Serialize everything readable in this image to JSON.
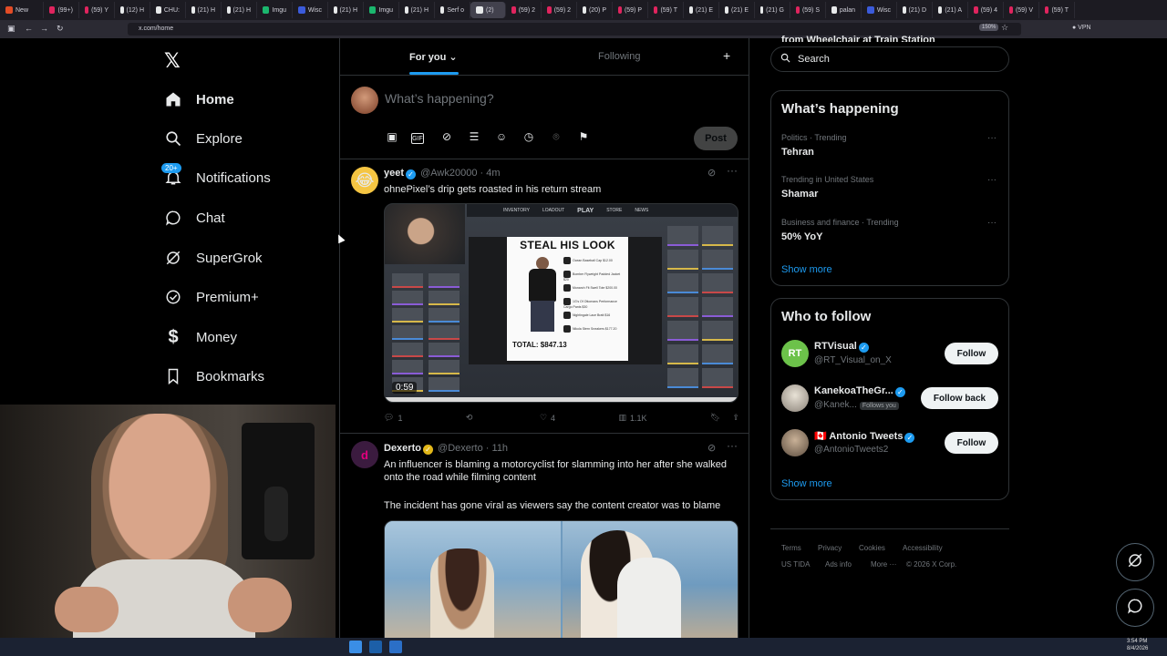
{
  "browser": {
    "tabs": [
      {
        "label": "New",
        "color": "#e34c26"
      },
      {
        "label": "(99+)",
        "color": "#e0245e"
      },
      {
        "label": "(59) Y",
        "color": "#e0245e"
      },
      {
        "label": "(12) H",
        "color": "#e7e9ea"
      },
      {
        "label": "CHU:",
        "color": "#e7e9ea"
      },
      {
        "label": "(21) H",
        "color": "#e7e9ea"
      },
      {
        "label": "(21) H",
        "color": "#e7e9ea"
      },
      {
        "label": "Imgu",
        "color": "#1bb76e"
      },
      {
        "label": "Wisc",
        "color": "#3b5bdb"
      },
      {
        "label": "(21) H",
        "color": "#e7e9ea"
      },
      {
        "label": "Imgu",
        "color": "#1bb76e"
      },
      {
        "label": "(21) H",
        "color": "#e7e9ea"
      },
      {
        "label": "Serf o",
        "color": "#e7e9ea"
      },
      {
        "label": "(2)",
        "color": "#e7e9ea",
        "active": true
      },
      {
        "label": "(59) 2",
        "color": "#e0245e"
      },
      {
        "label": "(59) 2",
        "color": "#e0245e"
      },
      {
        "label": "(20) P",
        "color": "#e7e9ea"
      },
      {
        "label": "(59) P",
        "color": "#e0245e"
      },
      {
        "label": "(59) T",
        "color": "#e0245e"
      },
      {
        "label": "(21) E",
        "color": "#e7e9ea"
      },
      {
        "label": "(21) E",
        "color": "#e7e9ea"
      },
      {
        "label": "(21) G",
        "color": "#e7e9ea"
      },
      {
        "label": "(59) S",
        "color": "#e0245e"
      },
      {
        "label": "palan",
        "color": "#e7e9ea"
      },
      {
        "label": "Wisc",
        "color": "#3b5bdb"
      },
      {
        "label": "(21) D",
        "color": "#e7e9ea"
      },
      {
        "label": "(21) A",
        "color": "#e7e9ea"
      },
      {
        "label": "(59) 4",
        "color": "#e0245e"
      },
      {
        "label": "(59) V",
        "color": "#e0245e"
      },
      {
        "label": "(59) T",
        "color": "#e0245e"
      }
    ],
    "url": "x.com/home",
    "zoom": "150%",
    "vpn": "VPN"
  },
  "nav": {
    "home": "Home",
    "explore": "Explore",
    "notifications": "Notifications",
    "notifications_badge": "20+",
    "chat": "Chat",
    "supergrok": "SuperGrok",
    "premium": "Premium+",
    "money": "Money",
    "bookmarks": "Bookmarks"
  },
  "feed_tabs": {
    "for_you": "For you",
    "following": "Following"
  },
  "compose": {
    "placeholder": "What’s happening?",
    "post": "Post"
  },
  "tweets": [
    {
      "name": "yeet",
      "handle": "@Awk20000",
      "time": "4m",
      "text": "ohnePixel’s drip gets roasted in his return stream",
      "media": {
        "duration": "0:59",
        "overlay_title": "STEAL HIS LOOK",
        "overlay_total": "TOTAL: $847.13",
        "shop_tabs": [
          "INVENTORY",
          "LOADOUT",
          "PLAY",
          "STORE",
          "NEWS"
        ],
        "items": [
          "Ocean Baseball Cap",
          "Bomber Flyweight Padded Jacket",
          "Monarch Fit Swell Tote",
          "1G's Of Ottomans Performance Cargo Pants",
          "Nightingale Lace Bratt",
          "Nikola Stern Sneakers"
        ],
        "prices": [
          "$12.00",
          "$20",
          "$200.00",
          "$30",
          "$16",
          "$177.20"
        ]
      },
      "replies": "1",
      "reposts": "",
      "likes": "4",
      "views": "1.1K"
    },
    {
      "name": "Dexerto",
      "handle": "@Dexerto",
      "time": "11h",
      "text1": "An influencer is blaming a motorcyclist for slamming into her after she walked onto the road while filming content",
      "text2": "The incident has gone viral as viewers say the content creator was to blame"
    }
  ],
  "sidebar": {
    "search_placeholder": "Search",
    "overflow_title": "from Wheelchair at Train Station",
    "happening_title": "What’s happening",
    "trends": [
      {
        "context": "Politics · Trending",
        "name": "Tehran"
      },
      {
        "context": "Trending in United States",
        "name": "Shamar"
      },
      {
        "context": "Business and finance · Trending",
        "name": "50% YoY"
      }
    ],
    "show_more": "Show more",
    "who_title": "Who to follow",
    "follow_list": [
      {
        "name": "RTVisual",
        "handle": "@RT_Visual_on_X",
        "button": "Follow",
        "avatar_text": "RT"
      },
      {
        "name": "KanekoaTheGr...",
        "handle": "@Kanek...",
        "follows_you": "Follows you",
        "button": "Follow back"
      },
      {
        "name": "Antonio Tweets",
        "handle": "@AntonioTweets2",
        "button": "Follow",
        "flag": "🇨🇦"
      }
    ],
    "show_more_2": "Show more",
    "footer": [
      "Terms",
      "Privacy",
      "Cookies",
      "Accessibility",
      "US TIDA",
      "Ads info",
      "More ···",
      "© 2026 X Corp."
    ]
  },
  "taskbar": {
    "time": "3:54 PM",
    "date": "8/4/2026"
  }
}
